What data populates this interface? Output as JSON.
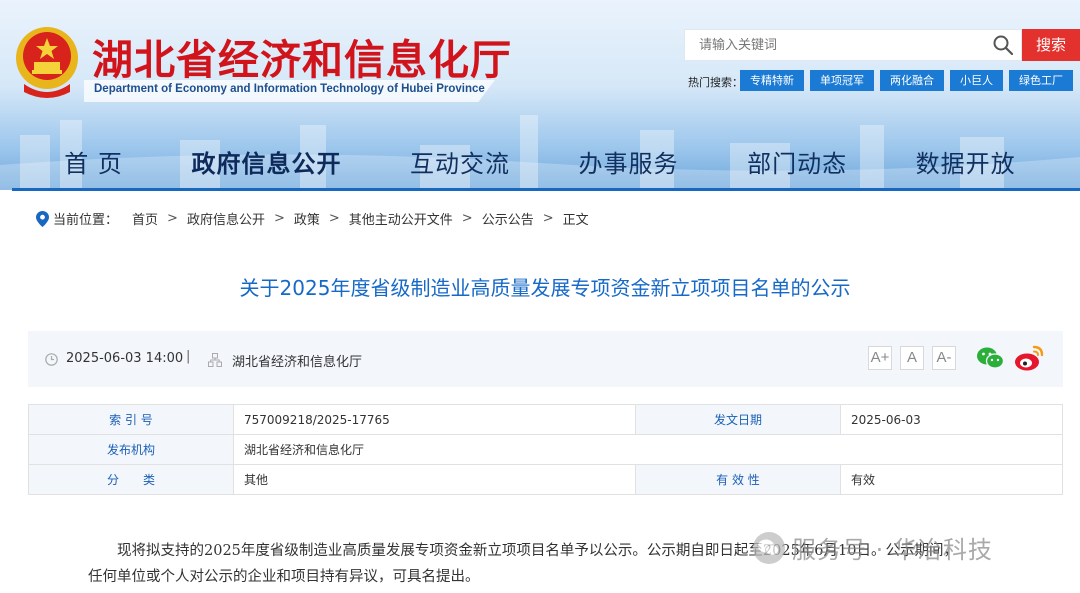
{
  "header": {
    "site_title": "湖北省经济和信息化厅",
    "site_subtitle": "Department of Economy and Information Technology of Hubei Province",
    "search_placeholder": "请输入关键词",
    "search_button": "搜索",
    "hot_label": "热门搜索：",
    "hot_tags": [
      "专精特新",
      "单项冠军",
      "两化融合",
      "小巨人",
      "绿色工厂"
    ],
    "colors": {
      "title_red": "#d1141b",
      "accent_blue": "#1b7ad4",
      "search_red": "#e3312d"
    }
  },
  "nav": {
    "items": [
      "首 页",
      "政府信息公开",
      "互动交流",
      "办事服务",
      "部门动态",
      "数据开放"
    ],
    "active_index": 1
  },
  "breadcrumb": {
    "label": "当前位置：",
    "items": [
      "首页",
      "政府信息公开",
      "政策",
      "其他主动公开文件",
      "公示公告",
      "正文"
    ],
    "separator": ">"
  },
  "article": {
    "title": "关于2025年度省级制造业高质量发展专项资金新立项项目名单的公示",
    "date": "2025-06-03 14:00",
    "meta_separator": "|",
    "publisher": "湖北省经济和信息化厅",
    "font_sizes": [
      "A+",
      "A",
      "A-"
    ],
    "info": {
      "index_label": "索 引 号",
      "index_value": "757009218/2025-17765",
      "issue_date_label": "发文日期",
      "issue_date_value": "2025-06-03",
      "org_label": "发布机构",
      "org_value": "湖北省经济和信息化厅",
      "category_label": "分　　类",
      "category_value": "其他",
      "validity_label": "有 效 性",
      "validity_value": "有效"
    },
    "body_line1": "现将拟支持的2025年度省级制造业高质量发展专项资金新立项项目名单予以公示。公示期自即日起至2025年6月10日。公示期间，",
    "body_line2": "任何单位或个人对公示的企业和项目持有异议，可具名提出。"
  },
  "watermark": {
    "text": "服务号 · 华冶科技"
  }
}
